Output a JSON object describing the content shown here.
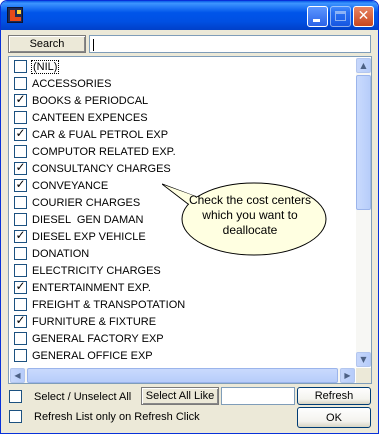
{
  "window": {
    "title": "",
    "accent": "#0055ea",
    "controls": [
      "minimize-icon",
      "maximize-icon",
      "close-icon"
    ],
    "close_glyph": "✕"
  },
  "search": {
    "button_label": "Search",
    "value": ""
  },
  "list": {
    "items": [
      {
        "label": "(NIL)",
        "checked": false,
        "focused": true
      },
      {
        "label": "ACCESSORIES",
        "checked": false
      },
      {
        "label": "BOOKS & PERIODCAL",
        "checked": true
      },
      {
        "label": "CANTEEN EXPENCES",
        "checked": false
      },
      {
        "label": "CAR & FUAL PETROL EXP",
        "checked": true
      },
      {
        "label": "COMPUTOR RELATED EXP.",
        "checked": false
      },
      {
        "label": "CONSULTANCY CHARGES",
        "checked": true
      },
      {
        "label": "CONVEYANCE",
        "checked": true
      },
      {
        "label": "COURIER CHARGES",
        "checked": false
      },
      {
        "label": "DIESEL  GEN DAMAN",
        "checked": false
      },
      {
        "label": "DIESEL EXP VEHICLE",
        "checked": true
      },
      {
        "label": "DONATION",
        "checked": false
      },
      {
        "label": "ELECTRICITY CHARGES",
        "checked": false
      },
      {
        "label": "ENTERTAINMENT EXP.",
        "checked": true
      },
      {
        "label": "FREIGHT & TRANSPOTATION",
        "checked": false
      },
      {
        "label": "FURNITURE & FIXTURE",
        "checked": true
      },
      {
        "label": "GENERAL FACTORY EXP",
        "checked": false
      },
      {
        "label": "GENERAL OFFICE EXP",
        "checked": false
      }
    ],
    "check_glyph": "✓",
    "scroll_up_glyph": "▲",
    "scroll_down_glyph": "▼",
    "scroll_left_glyph": "◀",
    "scroll_right_glyph": "▶"
  },
  "tooltip": {
    "text": "Check the cost centers which you want to deallocate",
    "fill": "#ffffe1"
  },
  "footer": {
    "select_unselect_all": "Select / Unselect All",
    "refresh_only": "Refresh List only on Refresh Click",
    "select_all_like": "Select All Like",
    "like_value": "",
    "refresh_button": "Refresh",
    "ok_button": "OK"
  }
}
